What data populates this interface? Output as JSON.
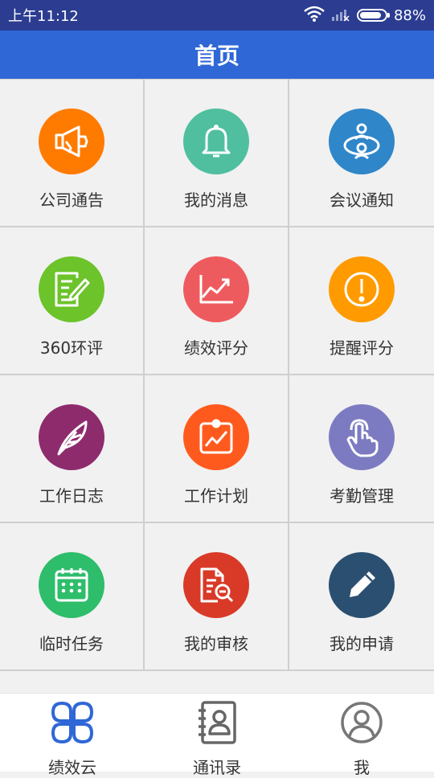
{
  "status_bar": {
    "time": "上午11:12",
    "battery_text": "88%",
    "battery_level": 0.88
  },
  "header": {
    "title": "首页"
  },
  "grid": {
    "items": [
      {
        "label": "公司通告",
        "icon": "megaphone-icon",
        "color": "#ff7b00"
      },
      {
        "label": "我的消息",
        "icon": "bell-icon",
        "color": "#4fbfa0"
      },
      {
        "label": "会议通知",
        "icon": "meeting-icon",
        "color": "#2f86c9"
      },
      {
        "label": "360环评",
        "icon": "edit-document-icon",
        "color": "#6cc32a"
      },
      {
        "label": "绩效评分",
        "icon": "trend-chart-icon",
        "color": "#ee5b5e"
      },
      {
        "label": "提醒评分",
        "icon": "alert-icon",
        "color": "#ff9b00"
      },
      {
        "label": "工作日志",
        "icon": "feather-icon",
        "color": "#8e2b6d"
      },
      {
        "label": "工作计划",
        "icon": "plan-chart-icon",
        "color": "#ff5a1e"
      },
      {
        "label": "考勤管理",
        "icon": "tap-hand-icon",
        "color": "#7c7bc2"
      },
      {
        "label": "临时任务",
        "icon": "calendar-icon",
        "color": "#2ebd6b"
      },
      {
        "label": "我的审核",
        "icon": "document-search-icon",
        "color": "#d93a28"
      },
      {
        "label": "我的申请",
        "icon": "pencil-icon",
        "color": "#2b4f70"
      }
    ]
  },
  "tabbar": {
    "tabs": [
      {
        "label": "绩效云",
        "icon": "clover-icon",
        "active": true
      },
      {
        "label": "通讯录",
        "icon": "contacts-book-icon",
        "active": false
      },
      {
        "label": "我",
        "icon": "user-icon",
        "active": false
      }
    ]
  },
  "colors": {
    "status_bar": "#2b3c91",
    "title_bar": "#2f67d6",
    "active_tab": "#2f67d6"
  }
}
